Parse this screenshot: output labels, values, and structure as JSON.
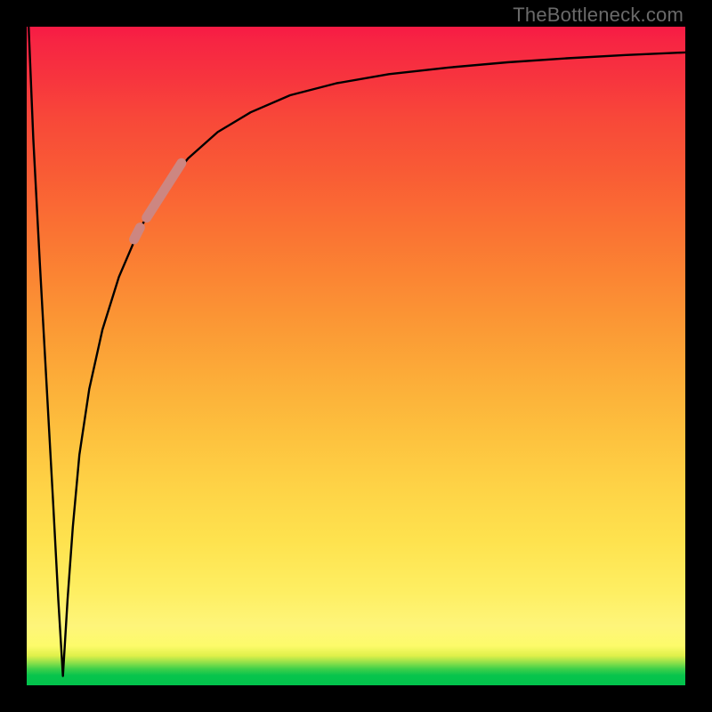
{
  "attribution": "TheBottleneck.com",
  "chart_data": {
    "type": "line",
    "title": "",
    "xlabel": "",
    "ylabel": "",
    "xlim": [
      0,
      100
    ],
    "ylim": [
      0,
      100
    ],
    "grid": false,
    "notch_x": 5.5,
    "series": [
      {
        "name": "curve",
        "color": "#000000",
        "x": [
          0.3,
          1.0,
          2.0,
          3.0,
          4.0,
          4.8,
          5.5,
          6.2,
          7.0,
          8.0,
          9.5,
          11.5,
          14.0,
          17.0,
          20.5,
          24.5,
          29.0,
          34.0,
          40.0,
          47.0,
          55.0,
          64.0,
          73.0,
          82.0,
          91.0,
          100.0
        ],
        "y": [
          100.0,
          83.0,
          64.0,
          46.0,
          28.0,
          13.0,
          1.4,
          13.0,
          24.0,
          35.0,
          45.0,
          54.0,
          62.0,
          69.0,
          75.0,
          80.0,
          84.0,
          87.0,
          89.6,
          91.4,
          92.8,
          93.8,
          94.6,
          95.2,
          95.7,
          96.1
        ]
      }
    ],
    "highlight_segments": [
      {
        "name": "top-segment",
        "color": "#cd8681",
        "width": 11,
        "points": [
          [
            18.2,
            71.0
          ],
          [
            23.5,
            79.3
          ]
        ]
      },
      {
        "name": "lower-dot",
        "color": "#cd8681",
        "width": 11,
        "points": [
          [
            16.3,
            67.7
          ],
          [
            17.2,
            69.5
          ]
        ]
      }
    ],
    "background_gradient_stops": [
      {
        "p": 0,
        "c": "#02c24c"
      },
      {
        "p": 6,
        "c": "#fdfb6a"
      },
      {
        "p": 50,
        "c": "#fcae39"
      },
      {
        "p": 100,
        "c": "#f71a44"
      }
    ]
  }
}
